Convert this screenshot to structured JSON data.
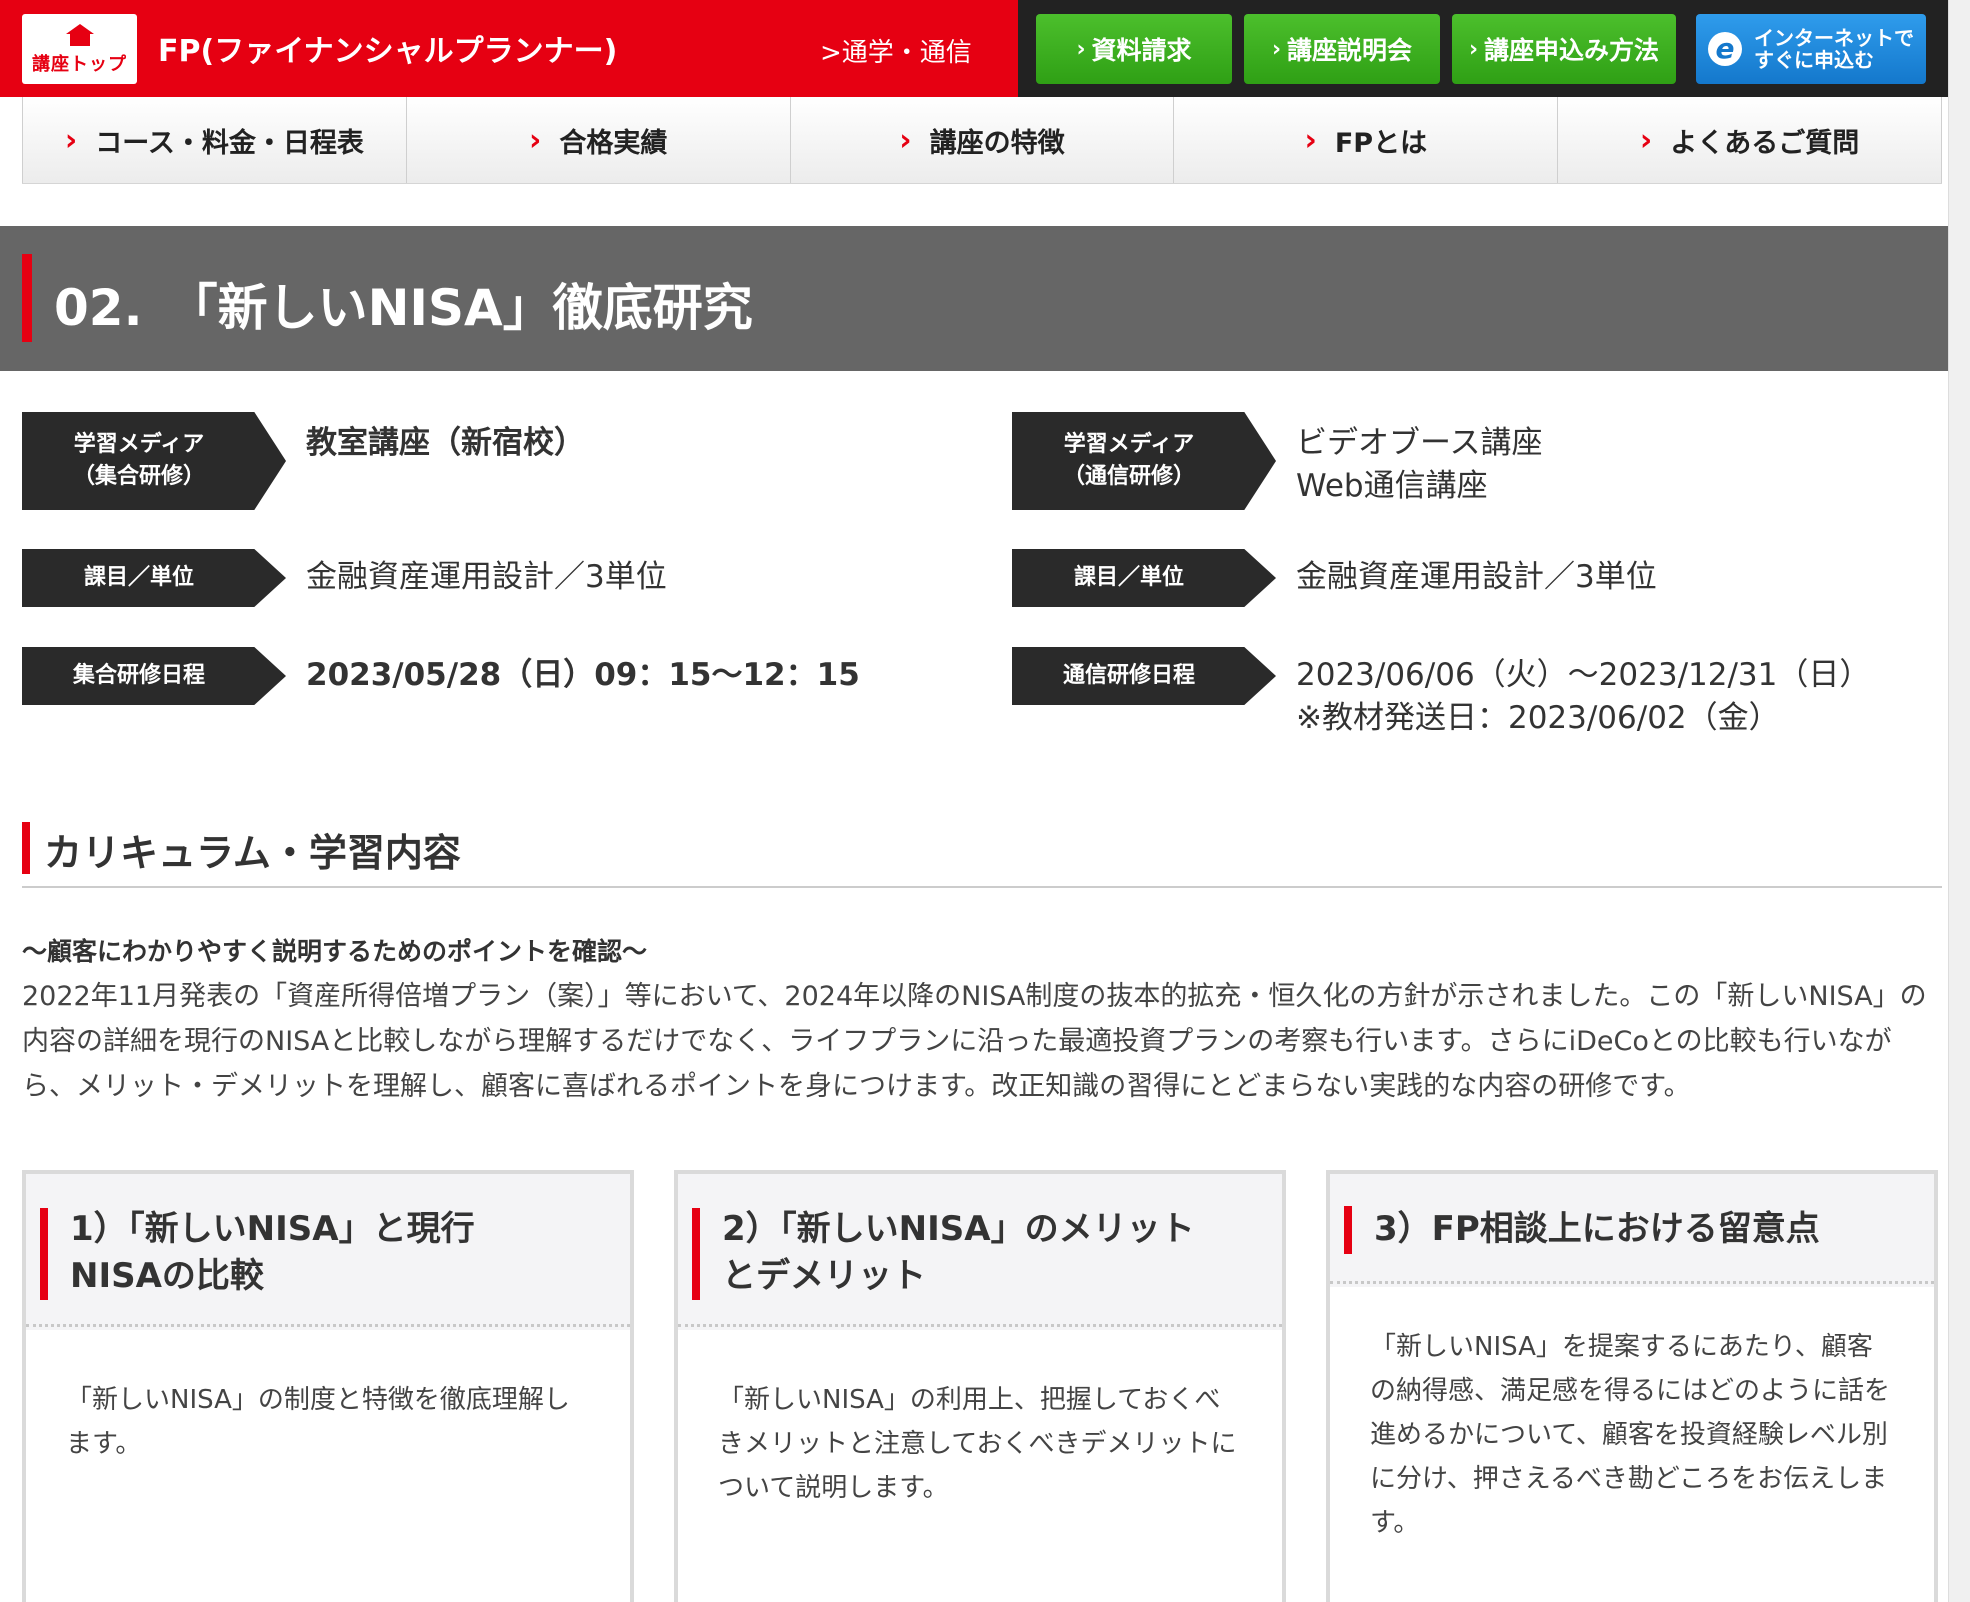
{
  "header": {
    "logo_text": "講座トップ",
    "site_title": "FP(ファイナンシャルプランナー)",
    "sub_label": ">通学・通信",
    "buttons": [
      {
        "label": "資料請求",
        "icon": "chevron-right"
      },
      {
        "label": "講座説明会",
        "icon": "chevron-right"
      },
      {
        "label": "講座申込み方法",
        "icon": "chevron-right"
      }
    ],
    "apply_button": {
      "line1": "インターネットで",
      "line2": "すぐに申込む",
      "icon_letter": "e"
    },
    "colors": {
      "primary_red": "#e60012",
      "dark": "#222222",
      "green": "#3cb01f",
      "blue": "#1e88dc"
    }
  },
  "nav": {
    "items": [
      {
        "label": "コース・料金・日程表"
      },
      {
        "label": "合格実績"
      },
      {
        "label": "講座の特徴"
      },
      {
        "label": "FPとは"
      },
      {
        "label": "よくあるご質問"
      }
    ]
  },
  "page": {
    "title": "02.　「新しいNISA」徹底研究"
  },
  "info": {
    "left": [
      {
        "tag_line1": "学習メディア",
        "tag_line2": "（集合研修）",
        "value": "教室講座（新宿校）"
      },
      {
        "tag": "課目／単位",
        "value": "金融資産運用設計／3単位"
      },
      {
        "tag": "集合研修日程",
        "value": "2023/05/28（日）09：15〜12：15"
      }
    ],
    "right": [
      {
        "tag_line1": "学習メディア",
        "tag_line2": "（通信研修）",
        "value_line1": "ビデオブース講座",
        "value_line2": "Web通信講座"
      },
      {
        "tag": "課目／単位",
        "value": "金融資産運用設計／3単位"
      },
      {
        "tag": "通信研修日程",
        "value_line1": "2023/06/06（火）〜2023/12/31（日）",
        "value_line2": "※教材発送日：2023/06/02（金）"
      }
    ]
  },
  "curriculum": {
    "heading": "カリキュラム・学習内容",
    "lead": "〜顧客にわかりやすく説明するためのポイントを確認〜",
    "body": "2022年11月発表の「資産所得倍増プラン（案）」等において、2024年以降のNISA制度の抜本的拡充・恒久化の方針が示されました。この「新しいNISA」の内容の詳細を現行のNISAと比較しながら理解するだけでなく、ライフプランに沿った最適投資プランの考察も行います。さらにiDeCoとの比較も行いながら、メリット・デメリットを理解し、顧客に喜ばれるポイントを身につけます。改正知識の習得にとどまらない実践的な内容の研修です。",
    "cards": [
      {
        "title_line1": "1）「新しいNISA」と現行",
        "title_line2": "NISAの比較",
        "text": "「新しいNISA」の制度と特徴を徹底理解します。"
      },
      {
        "title_line1": "2）「新しいNISA」のメリット",
        "title_line2": "とデメリット",
        "text": "「新しいNISA」の利用上、把握しておくべきメリットと注意しておくべきデメリットについて説明します。"
      },
      {
        "title_line1": "3）FP相談上における留意点",
        "title_line2": "",
        "text": "「新しいNISA」を提案するにあたり、顧客の納得感、満足感を得るにはどのように話を進めるかについて、顧客を投資経験レベル別に分け、押さえるべき勘どころをお伝えします。"
      }
    ]
  }
}
